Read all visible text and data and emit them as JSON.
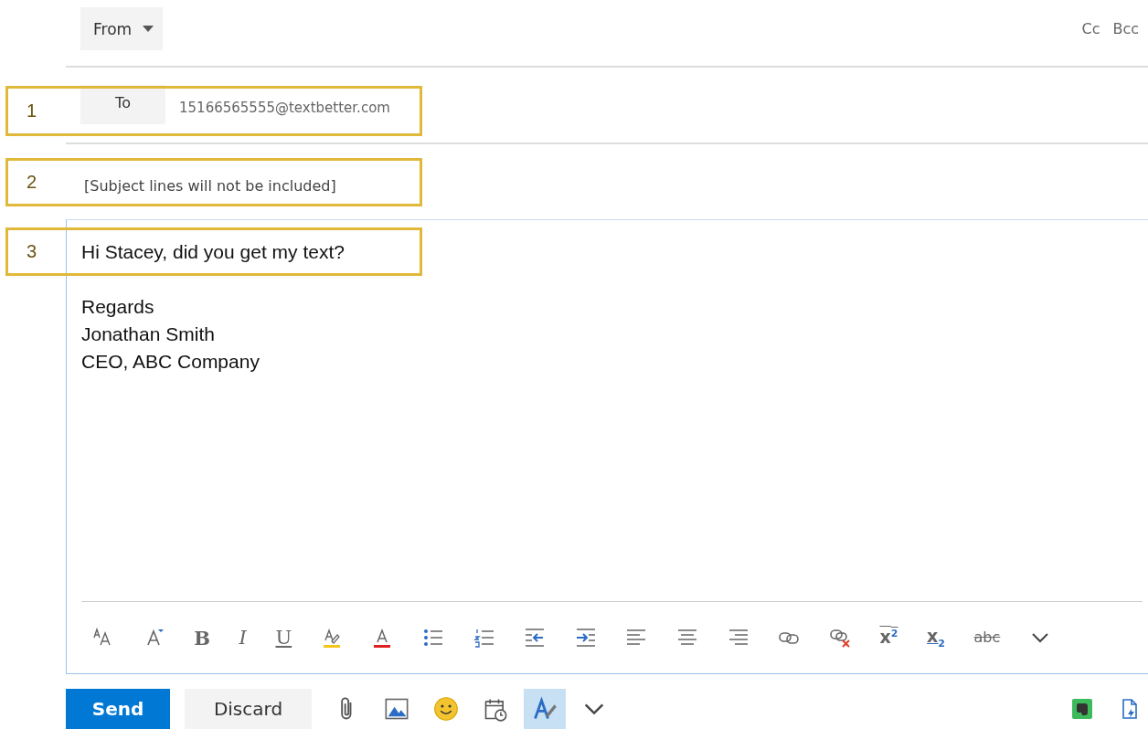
{
  "header": {
    "from_label": "From",
    "cc": "Cc",
    "bcc": "Bcc"
  },
  "to": {
    "label": "To",
    "value": "15166565555@textbetter.com"
  },
  "subject": {
    "value": "[Subject lines will not be included]"
  },
  "body": {
    "greeting": "Hi Stacey, did you get my text?",
    "signature": [
      "Regards",
      "Jonathan Smith",
      "CEO, ABC Company"
    ]
  },
  "format_toolbar": [
    {
      "kind": "font-size"
    },
    {
      "kind": "grow-font"
    },
    {
      "kind": "bold",
      "glyph": "B"
    },
    {
      "kind": "italic",
      "glyph": "I"
    },
    {
      "kind": "underline",
      "glyph": "U"
    },
    {
      "kind": "highlight"
    },
    {
      "kind": "font-color"
    },
    {
      "kind": "bullets"
    },
    {
      "kind": "numbering"
    },
    {
      "kind": "outdent"
    },
    {
      "kind": "indent"
    },
    {
      "kind": "align-left"
    },
    {
      "kind": "align-center"
    },
    {
      "kind": "align-right"
    },
    {
      "kind": "link"
    },
    {
      "kind": "unlink"
    },
    {
      "kind": "superscript",
      "glyph": "x$^{2}$"
    },
    {
      "kind": "subscript",
      "glyph": "x$_{2}$"
    },
    {
      "kind": "strikethrough",
      "glyph": "abc"
    },
    {
      "kind": "more"
    }
  ],
  "actions": {
    "send": "Send",
    "discard": "Discard"
  },
  "action_icons": [
    {
      "kind": "attach",
      "selected": false
    },
    {
      "kind": "picture",
      "selected": false
    },
    {
      "kind": "emoji",
      "selected": false
    },
    {
      "kind": "schedule",
      "selected": false
    },
    {
      "kind": "format",
      "selected": true
    },
    {
      "kind": "more",
      "selected": false
    }
  ],
  "addins": [
    {
      "kind": "evernote"
    },
    {
      "kind": "document"
    }
  ],
  "callouts": [
    {
      "label": "1"
    },
    {
      "label": "2"
    },
    {
      "label": "3"
    }
  ]
}
